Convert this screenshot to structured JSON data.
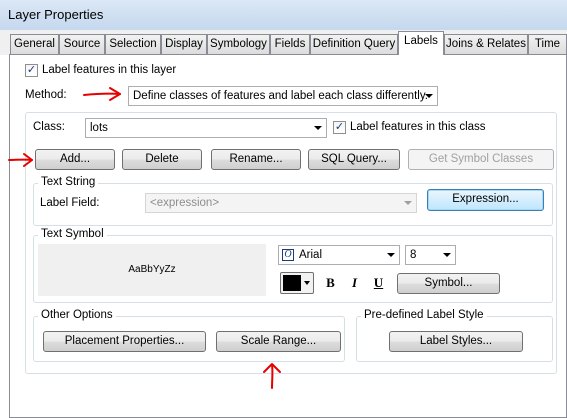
{
  "window": {
    "title": "Layer Properties"
  },
  "tabs": [
    "General",
    "Source",
    "Selection",
    "Display",
    "Symbology",
    "Fields",
    "Definition Query",
    "Labels",
    "Joins & Relates",
    "Time"
  ],
  "active_tab": "Labels",
  "label_features_in_layer": {
    "label": "Label features in this layer",
    "checked": true
  },
  "method": {
    "label": "Method:",
    "value": "Define classes of features and label each class differently."
  },
  "class": {
    "label": "Class:",
    "value": "lots"
  },
  "label_features_in_class": {
    "label": "Label features in this class",
    "checked": true
  },
  "class_buttons": {
    "add": "Add...",
    "delete": "Delete",
    "rename": "Rename...",
    "sql_query": "SQL Query...",
    "get_symbol_classes": "Get Symbol Classes"
  },
  "text_string": {
    "legend": "Text String",
    "label_field": "Label Field:",
    "field_value": "<expression>",
    "expression_button": "Expression..."
  },
  "text_symbol": {
    "legend": "Text Symbol",
    "preview": "AaBbYyZz",
    "font": "Arial",
    "size": "8",
    "bold": "B",
    "italic": "I",
    "underline": "U",
    "symbol_button": "Symbol...",
    "color": "#000000"
  },
  "other_options": {
    "legend": "Other Options",
    "placement_button": "Placement Properties...",
    "scale_range_button": "Scale Range..."
  },
  "predefined": {
    "legend": "Pre-defined Label Style",
    "label_styles_button": "Label Styles..."
  },
  "annotation_color": "#e60000"
}
